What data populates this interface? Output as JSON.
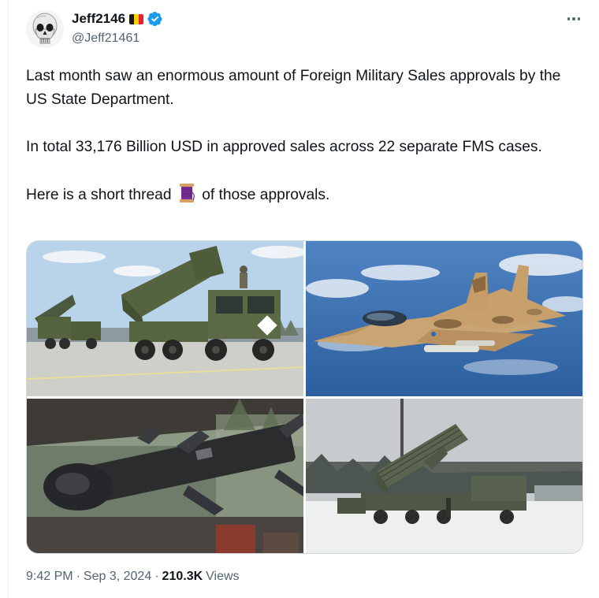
{
  "author": {
    "display_name": "Jeff2146",
    "handle": "@Jeff21461",
    "flag_colors": [
      "#1a1a1a",
      "#f6d300",
      "#e4262c"
    ],
    "verified": true
  },
  "icons": {
    "verified": "verified-badge-icon",
    "more": "more-options-icon",
    "thread": "spool-of-thread-emoji"
  },
  "tweet": {
    "line1": "Last month saw an enormous amount of Foreign Military Sales approvals by the US State Department.",
    "line2": "In total 33,176 Billion USD in approved sales across 22 separate FMS cases.",
    "line3_before": "Here is a short thread",
    "line3_after": "of those approvals."
  },
  "media": [
    {
      "subject": "rocket-launcher-trucks-photo"
    },
    {
      "subject": "fighter-jet-photo"
    },
    {
      "subject": "missile-photo"
    },
    {
      "subject": "air-defense-launcher-photo"
    }
  ],
  "meta": {
    "time": "9:42 PM",
    "separator": "·",
    "date": "Sep 3, 2024",
    "views_count": "210.3K",
    "views_label": "Views"
  },
  "colors": {
    "accent": "#1d9bf0",
    "text": "#0f1419",
    "muted": "#536471",
    "border": "#cfd9de"
  }
}
